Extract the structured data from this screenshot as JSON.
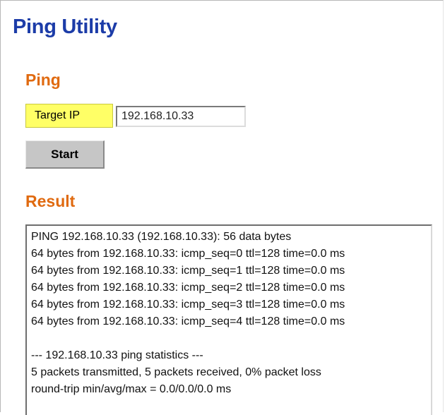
{
  "page": {
    "title": "Ping Utility"
  },
  "ping": {
    "section_title": "Ping",
    "target_label": "Target IP",
    "target_value": "192.168.10.33",
    "start_label": "Start"
  },
  "result": {
    "section_title": "Result",
    "lines": [
      "PING 192.168.10.33 (192.168.10.33): 56 data bytes",
      "64 bytes from 192.168.10.33: icmp_seq=0 ttl=128 time=0.0 ms",
      "64 bytes from 192.168.10.33: icmp_seq=1 ttl=128 time=0.0 ms",
      "64 bytes from 192.168.10.33: icmp_seq=2 ttl=128 time=0.0 ms",
      "64 bytes from 192.168.10.33: icmp_seq=3 ttl=128 time=0.0 ms",
      "64 bytes from 192.168.10.33: icmp_seq=4 ttl=128 time=0.0 ms",
      "",
      "--- 192.168.10.33 ping statistics ---",
      "5 packets transmitted, 5 packets received, 0% packet loss",
      "round-trip min/avg/max = 0.0/0.0/0.0 ms"
    ]
  },
  "colors": {
    "title": "#1c3ca8",
    "section": "#e06a10",
    "label_bg": "#ffff66",
    "button_bg": "#c6c6c6"
  }
}
